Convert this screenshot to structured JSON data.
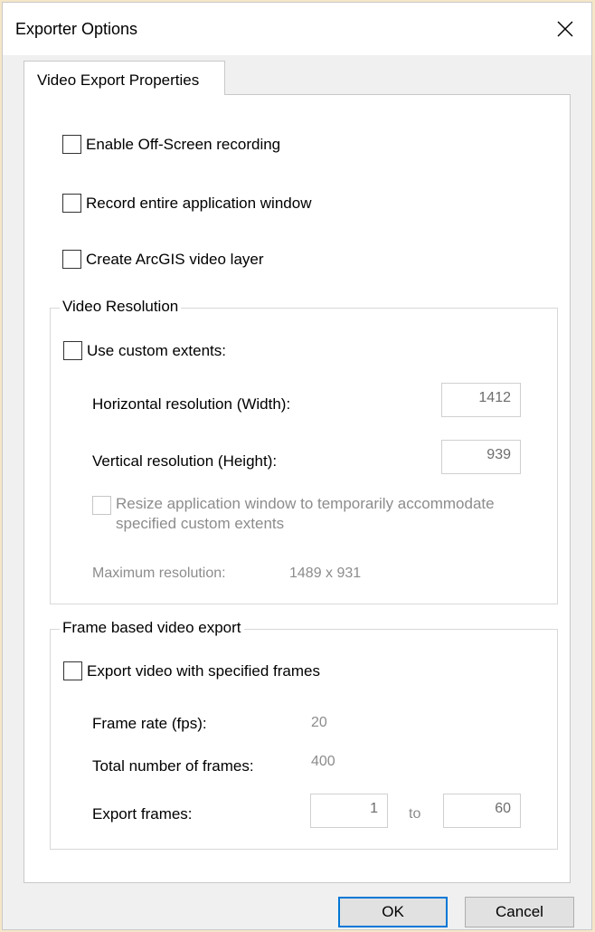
{
  "window": {
    "title": "Exporter Options"
  },
  "tabs": [
    {
      "label": "Video Export Properties"
    }
  ],
  "options": {
    "off_screen": {
      "label": "Enable Off-Screen recording",
      "checked": false
    },
    "entire_window": {
      "label": "Record entire application window",
      "checked": false
    },
    "video_layer": {
      "label": "Create ArcGIS video layer",
      "checked": false
    }
  },
  "video_resolution": {
    "title": "Video Resolution",
    "custom_extents": {
      "label": "Use custom extents:",
      "checked": false
    },
    "width_label": "Horizontal resolution (Width):",
    "width_value": "1412",
    "height_label": "Vertical resolution (Height):",
    "height_value": "939",
    "resize": {
      "label_line1": "Resize application window to temporarily accommodate",
      "label_line2": "specified custom extents",
      "checked": false
    },
    "max_label": "Maximum resolution:",
    "max_value": "1489 x 931"
  },
  "frame_export": {
    "title": "Frame based video export",
    "export_frames_check": {
      "label": "Export video with specified frames",
      "checked": false
    },
    "frame_rate_label": "Frame rate (fps):",
    "frame_rate_value": "20",
    "total_frames_label": "Total number of frames:",
    "total_frames_value": "400",
    "range_label": "Export frames:",
    "range_from": "1",
    "range_to_label": "to",
    "range_to": "60"
  },
  "buttons": {
    "ok": "OK",
    "cancel": "Cancel"
  },
  "icons": {
    "close": "close-icon"
  }
}
